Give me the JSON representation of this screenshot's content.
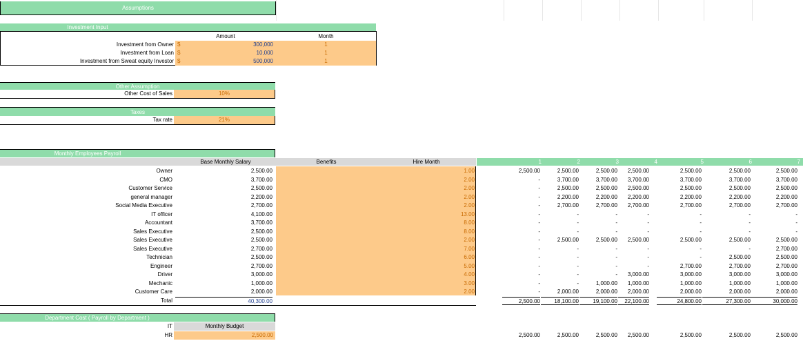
{
  "assumptions": {
    "title": "Assumptions"
  },
  "investment": {
    "title": "Investment Input",
    "col_amount": "Amount",
    "col_month": "Month",
    "rows": [
      {
        "label": "Investment from Owner",
        "currency": "$",
        "amount": "300,000",
        "month": "1"
      },
      {
        "label": "Investment from Loan",
        "currency": "$",
        "amount": "10,000",
        "month": "1"
      },
      {
        "label": "Investment from Sweat equity Investor",
        "currency": "$",
        "amount": "500,000",
        "month": "1"
      }
    ]
  },
  "other": {
    "title": "Other Assumption",
    "label": "Other Cost of Sales",
    "value": "10%"
  },
  "taxes": {
    "title": "Taxes",
    "label": "Tax rate",
    "value": "21%"
  },
  "payroll": {
    "title": "Monthly Employees Payroll",
    "col_salary": "Base Monthly Salary",
    "col_benefits": "Benefits",
    "col_hire": "Hire Month",
    "months": [
      "1",
      "2",
      "3",
      "4",
      "5",
      "6",
      "7"
    ],
    "rows": [
      {
        "label": "Owner",
        "salary": "2,500.00",
        "hire": "1.00",
        "m": [
          "2,500.00",
          "2,500.00",
          "2,500.00",
          "2,500.00",
          "2,500.00",
          "2,500.00",
          "2,500.00"
        ]
      },
      {
        "label": "CMO",
        "salary": "3,700.00",
        "hire": "2.00",
        "m": [
          "-",
          "3,700.00",
          "3,700.00",
          "3,700.00",
          "3,700.00",
          "3,700.00",
          "3,700.00"
        ]
      },
      {
        "label": "Customer Service",
        "salary": "2,500.00",
        "hire": "2.00",
        "m": [
          "-",
          "2,500.00",
          "2,500.00",
          "2,500.00",
          "2,500.00",
          "2,500.00",
          "2,500.00"
        ]
      },
      {
        "label": "general manager",
        "salary": "2,200.00",
        "hire": "2.00",
        "m": [
          "-",
          "2,200.00",
          "2,200.00",
          "2,200.00",
          "2,200.00",
          "2,200.00",
          "2,200.00"
        ]
      },
      {
        "label": "Social Media Executive",
        "salary": "2,700.00",
        "hire": "2.00",
        "m": [
          "-",
          "2,700.00",
          "2,700.00",
          "2,700.00",
          "2,700.00",
          "2,700.00",
          "2,700.00"
        ]
      },
      {
        "label": "IT officer",
        "salary": "4,100.00",
        "hire": "13.00",
        "m": [
          "-",
          "-",
          "-",
          "-",
          "-",
          "-",
          "-"
        ]
      },
      {
        "label": "Accountant",
        "salary": "3,700.00",
        "hire": "8.00",
        "m": [
          "-",
          "-",
          "-",
          "-",
          "-",
          "-",
          "-"
        ]
      },
      {
        "label": "Sales Executive",
        "salary": "2,500.00",
        "hire": "8.00",
        "m": [
          "-",
          "-",
          "-",
          "-",
          "-",
          "-",
          "-"
        ]
      },
      {
        "label": "Sales Executive",
        "salary": "2,500.00",
        "hire": "2.00",
        "m": [
          "-",
          "2,500.00",
          "2,500.00",
          "2,500.00",
          "2,500.00",
          "2,500.00",
          "2,500.00"
        ]
      },
      {
        "label": "Sales Executive",
        "salary": "2,700.00",
        "hire": "7.00",
        "m": [
          "-",
          "-",
          "-",
          "-",
          "-",
          "-",
          "2,700.00"
        ]
      },
      {
        "label": "Technician",
        "salary": "2,500.00",
        "hire": "6.00",
        "m": [
          "-",
          "-",
          "-",
          "-",
          "-",
          "2,500.00",
          "2,500.00"
        ]
      },
      {
        "label": "Engineer",
        "salary": "2,700.00",
        "hire": "5.00",
        "m": [
          "-",
          "-",
          "-",
          "-",
          "2,700.00",
          "2,700.00",
          "2,700.00"
        ]
      },
      {
        "label": "Driver",
        "salary": "3,000.00",
        "hire": "4.00",
        "m": [
          "-",
          "-",
          "-",
          "3,000.00",
          "3,000.00",
          "3,000.00",
          "3,000.00"
        ]
      },
      {
        "label": "Mechanic",
        "salary": "1,000.00",
        "hire": "3.00",
        "m": [
          "-",
          "-",
          "1,000.00",
          "1,000.00",
          "1,000.00",
          "1,000.00",
          "1,000.00"
        ]
      },
      {
        "label": "Customer Care",
        "salary": "2,000.00",
        "hire": "2.00",
        "m": [
          "-",
          "2,000.00",
          "2,000.00",
          "2,000.00",
          "2,000.00",
          "2,000.00",
          "2,000.00"
        ]
      }
    ],
    "total_label": "Total",
    "total_salary": "40,300.00",
    "totals": [
      "2,500.00",
      "18,100.00",
      "19,100.00",
      "22,100.00",
      "24,800.00",
      "27,300.00",
      "30,000.00"
    ]
  },
  "department": {
    "title": "Department Cost ( Payroll by Department )",
    "col_budget": "Monthly Budget",
    "rows": [
      {
        "label": "IT",
        "budget": ""
      },
      {
        "label": "HR",
        "budget": "2,500.00"
      }
    ],
    "hr_months": [
      "2,500.00",
      "2,500.00",
      "2,500.00",
      "2,500.00",
      "2,500.00",
      "2,500.00",
      "2,500.00"
    ]
  }
}
